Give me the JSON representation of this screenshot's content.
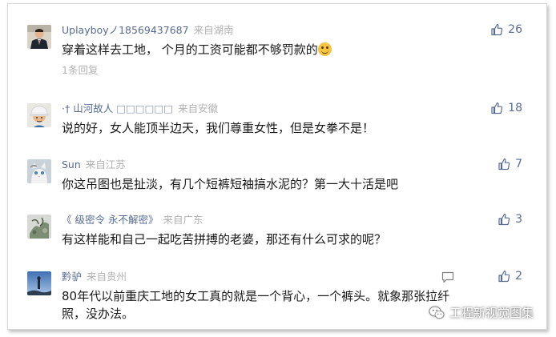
{
  "accent_color": "#576b95",
  "comments": [
    {
      "user": "Uplayboyノ18569437687",
      "location": "来自湖南",
      "text_before_emoji": "穿着这样去工地，    个月的工资可能都不够罚款的",
      "emoji": "grin-emoji",
      "reply_label": "1条回复",
      "likes": "26",
      "avatar": "avatar-man-suit"
    },
    {
      "user": "·† 山河故人",
      "user_suffix": "□□□□□□",
      "location": "来自安徽",
      "text": "说的好，女人能顶半边天，我们尊重女性，但是女拳不是！",
      "likes": "18",
      "avatar": "avatar-hardhat"
    },
    {
      "user": "Sun",
      "location": "来自江苏",
      "text": "你这吊图也是扯淡，有几个短裤短袖搞水泥的？第一大十活是吧",
      "likes": "7",
      "avatar": "avatar-cat"
    },
    {
      "user": "《  级密令 永不解密》",
      "location": "来自广东",
      "text": "有这样能和自己一起吃苦拼搏的老婆，那还有什么可求的呢？",
      "likes": "3",
      "avatar": "avatar-plant"
    },
    {
      "user": "黔驴",
      "location": "来自贵州",
      "text": "80年代以前重庆工地的女工真的就是一个背心，一个裤头。就象那张拉纤照，没办法。",
      "likes": "2",
      "avatar": "avatar-sky"
    }
  ],
  "watermark": "工程新视觉图集",
  "icons": {
    "like": "thumbs-up-icon",
    "reply": "message-icon",
    "watermark": "wechat-icon"
  }
}
